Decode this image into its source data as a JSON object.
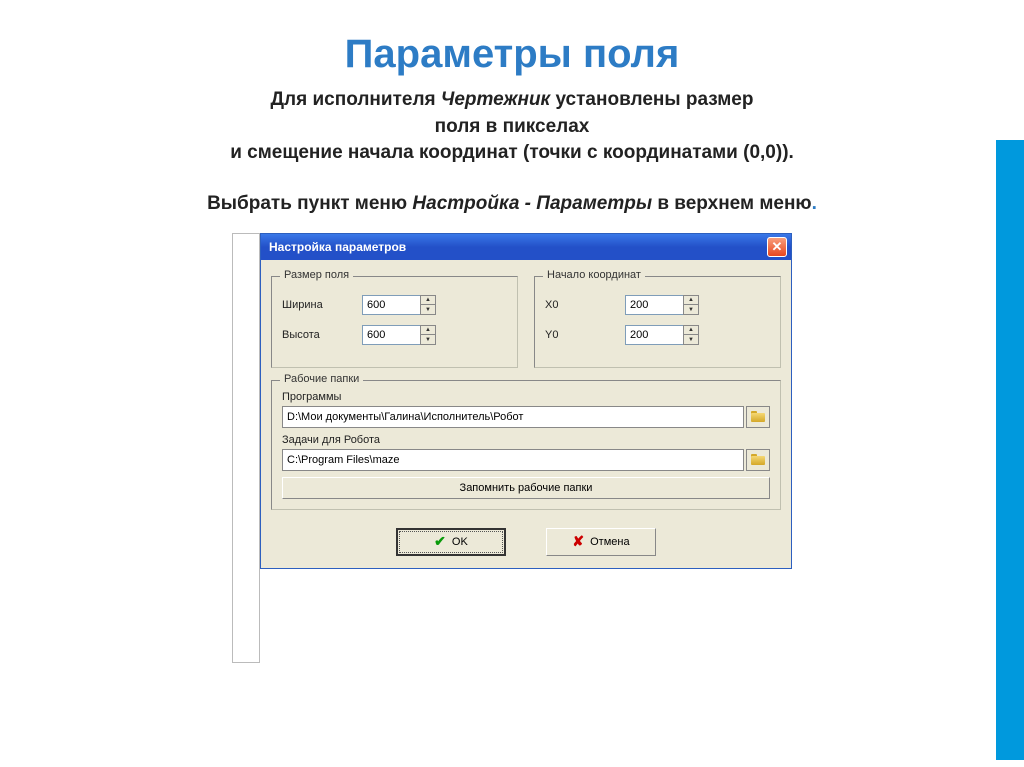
{
  "slide": {
    "title": "Параметры поля",
    "line1_a": "Для исполнителя ",
    "line1_em": "Чертежник",
    "line1_b": "  установлены размер",
    "line2": "поля в пикселах",
    "line3": "и смещение начала координат (точки с координатами (0,0)).",
    "line4_a": "Выбрать пункт меню ",
    "line4_em": "Настройка - Параметры",
    "line4_b": " в верхнем меню",
    "dot": "."
  },
  "dialog": {
    "title": "Настройка параметров",
    "groups": {
      "size": {
        "legend": "Размер поля",
        "width_label": "Ширина",
        "width_value": "600",
        "height_label": "Высота",
        "height_value": "600"
      },
      "origin": {
        "legend": "Начало координат",
        "x0_label": "X0",
        "x0_value": "200",
        "y0_label": "Y0",
        "y0_value": "200"
      },
      "folders": {
        "legend": "Рабочие папки",
        "programs_label": "Программы",
        "programs_path": "D:\\Мои документы\\Галина\\Исполнитель\\Робот",
        "tasks_label": "Задачи для Робота",
        "tasks_path": "C:\\Program Files\\maze",
        "remember_label": "Запомнить рабочие папки"
      }
    },
    "buttons": {
      "ok": "OK",
      "cancel": "Отмена"
    }
  }
}
